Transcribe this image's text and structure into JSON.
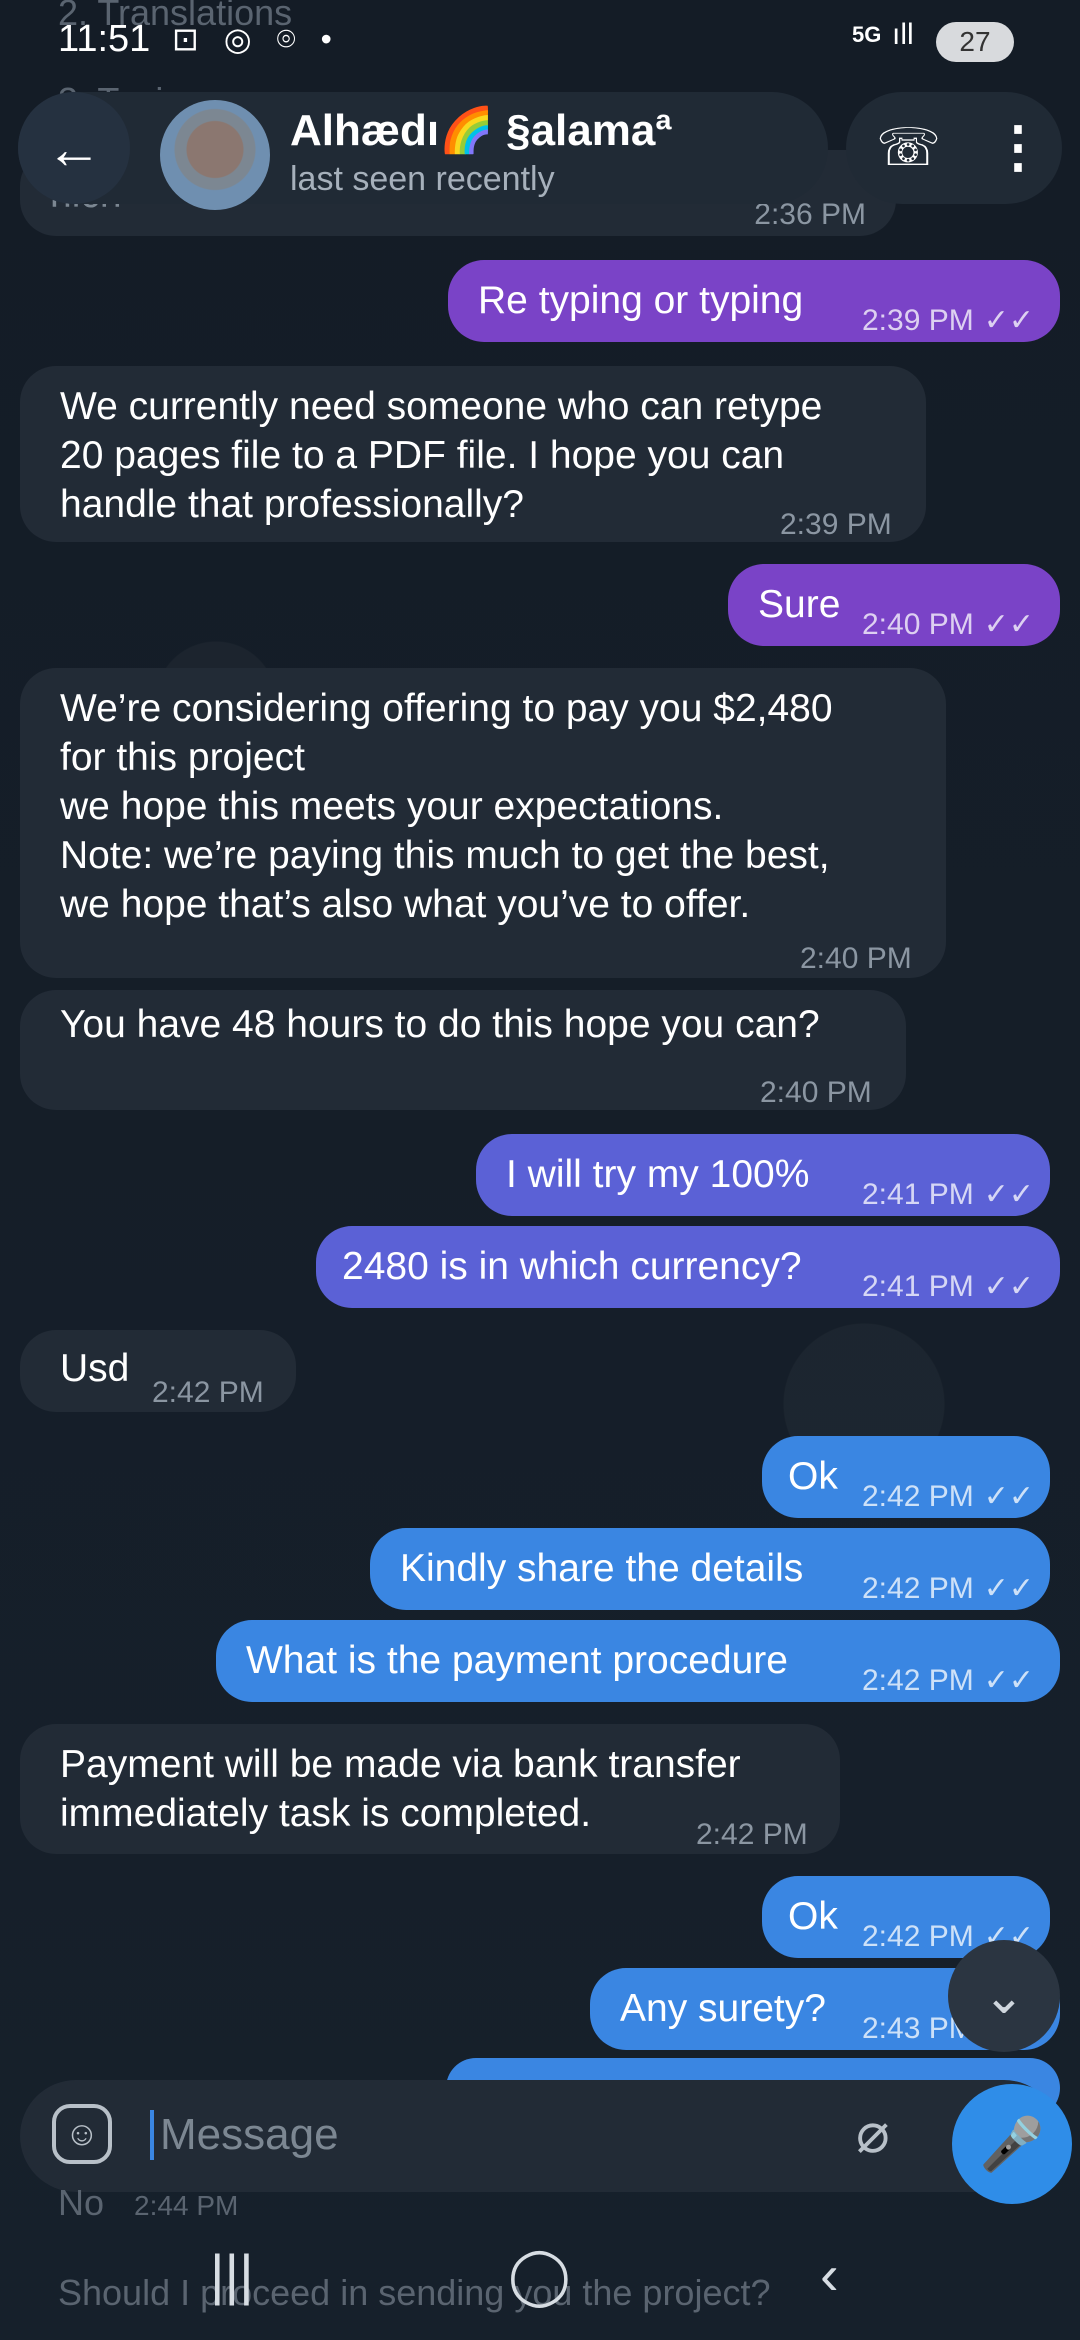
{
  "status_bar": {
    "time": "11:51",
    "notification_icons": "⊡ ◎ ⌾ •",
    "network": "5G",
    "signal": "ıll",
    "battery": "27"
  },
  "ghost_text": {
    "top1": "2. Translations",
    "top2": "3. Typi",
    "top3": "hich",
    "top3_time": "2:36 PM",
    "bottom1": "No",
    "bottom1_time": "2:44 PM",
    "bottom2": "Should I proceed in sending you the project?"
  },
  "header": {
    "contact_name": "Alhædı🌈 §alamaª",
    "contact_status": "last seen recently"
  },
  "messages": [
    {
      "text": "Re typing or typing",
      "time": "2:39 PM",
      "ticks": "✓✓"
    },
    {
      "text": "We currently need someone who can retype\n20 pages file to a PDF file. I hope you can\nhandle that professionally?",
      "time": "2:39 PM"
    },
    {
      "text": "Sure",
      "time": "2:40 PM",
      "ticks": "✓✓"
    },
    {
      "text": "We’re considering offering to pay you $2,480\nfor this project\nwe hope this meets your expectations.\nNote: we’re paying this much to get the best,\nwe hope that’s also what you’ve to offer.",
      "time": "2:40 PM"
    },
    {
      "text": "You have 48 hours to do this hope you can?",
      "time": "2:40 PM"
    },
    {
      "text": "I will try my 100%",
      "time": "2:41 PM",
      "ticks": "✓✓"
    },
    {
      "text": "2480 is in which currency?",
      "time": "2:41 PM",
      "ticks": "✓✓"
    },
    {
      "text": "Usd",
      "time": "2:42 PM"
    },
    {
      "text": "Ok",
      "time": "2:42 PM",
      "ticks": "✓✓"
    },
    {
      "text": "Kindly share the details",
      "time": "2:42 PM",
      "ticks": "✓✓"
    },
    {
      "text": "What is the payment procedure",
      "time": "2:42 PM",
      "ticks": "✓✓"
    },
    {
      "text": "Payment will be made via bank transfer\nimmediately task is completed.",
      "time": "2:42 PM"
    },
    {
      "text": "Ok",
      "time": "2:42 PM",
      "ticks": "✓✓"
    },
    {
      "text": "Any surety?",
      "time": "2:43 PM"
    }
  ],
  "input": {
    "placeholder": "Message"
  },
  "icons": {
    "back": "←",
    "phone": "☏",
    "menu": "⋮",
    "scroll_down": "⌄",
    "emoji": "☺",
    "attach": "⌀",
    "mic": "🎤",
    "nav_recent": "|||",
    "nav_home": "◯",
    "nav_back": "‹"
  }
}
